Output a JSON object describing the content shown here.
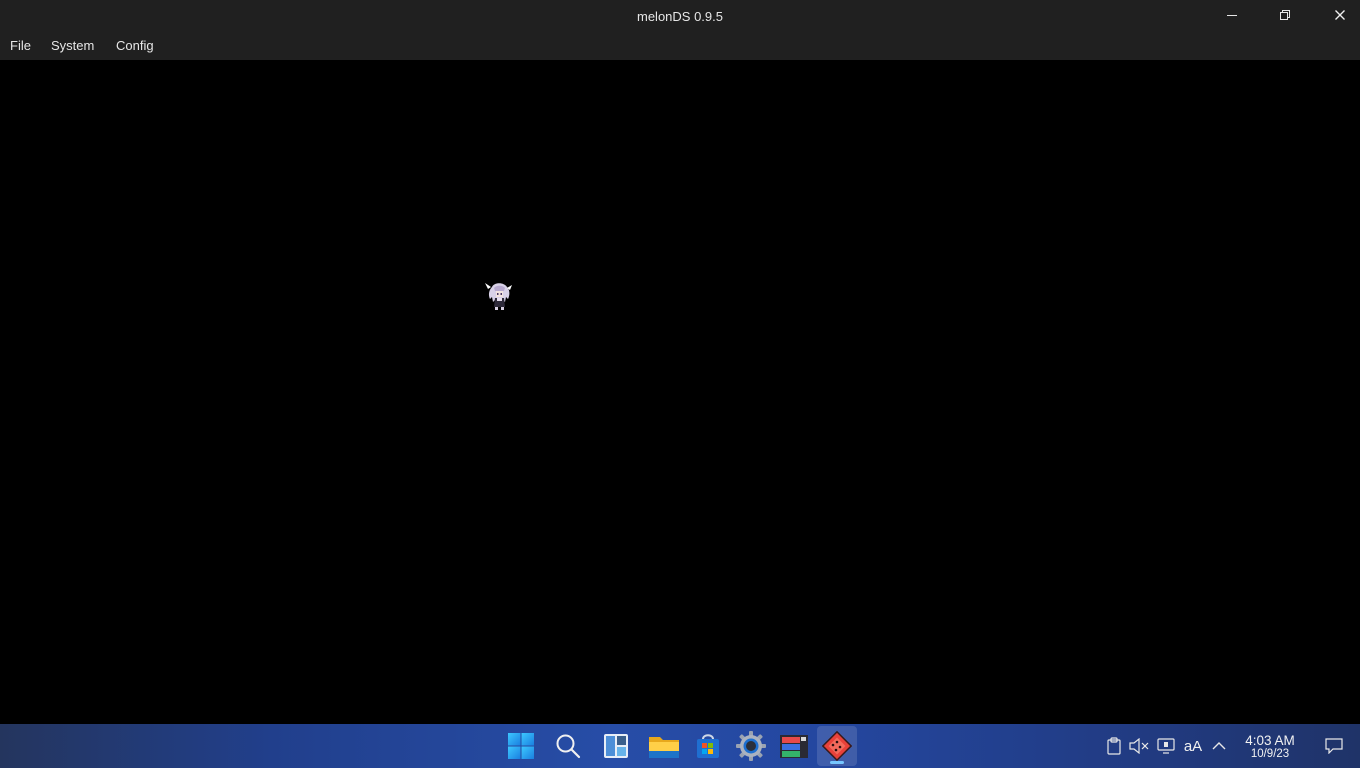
{
  "window": {
    "title": "melonDS 0.9.5"
  },
  "menubar": {
    "items": [
      {
        "label": "File"
      },
      {
        "label": "System"
      },
      {
        "label": "Config"
      }
    ]
  },
  "taskbar": {
    "apps": [
      {
        "icon": "windows-start-icon"
      },
      {
        "icon": "search-icon"
      },
      {
        "icon": "widgets-icon"
      },
      {
        "icon": "file-explorer-icon"
      },
      {
        "icon": "microsoft-store-icon"
      },
      {
        "icon": "settings-gear-icon"
      },
      {
        "icon": "app-grid-icon"
      },
      {
        "icon": "melonds-icon",
        "active": true
      }
    ],
    "tray": {
      "text_size_label": "aA",
      "time": "4:03 AM",
      "date": "10/9/23"
    }
  },
  "colors": {
    "titlebar": "#202020",
    "accent_indicator": "#76c6ff"
  }
}
